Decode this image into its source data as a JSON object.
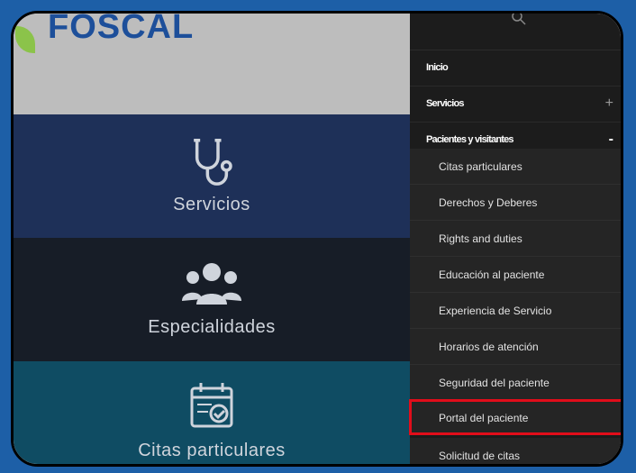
{
  "brand": {
    "logo_text": "FOSCAL"
  },
  "tiles": [
    {
      "label": "Servicios",
      "icon": "stethoscope-icon"
    },
    {
      "label": "Especialidades",
      "icon": "people-group-icon"
    },
    {
      "label": "Citas particulares",
      "icon": "calendar-check-icon"
    }
  ],
  "menu": {
    "search_icon": "search-icon",
    "items": [
      {
        "label": "Inicio",
        "sign": ""
      },
      {
        "label": "Servicios",
        "sign": "+"
      },
      {
        "label": "Pacientes y visitantes",
        "sign": "-"
      }
    ],
    "subitems": [
      {
        "label": "Citas particulares"
      },
      {
        "label": "Derechos y Deberes"
      },
      {
        "label": "Rights and duties"
      },
      {
        "label": "Educación al paciente"
      },
      {
        "label": "Experiencia de Servicio"
      },
      {
        "label": "Horarios de atención"
      },
      {
        "label": "Seguridad del paciente"
      },
      {
        "label": "Portal del paciente"
      },
      {
        "label": "Solicitud de citas"
      }
    ],
    "highlighted_subitem": "Portal del paciente"
  },
  "colors": {
    "background": "#1d5fa7",
    "tile_services": "#1e3058",
    "tile_specialties": "#171d27",
    "tile_appointments": "#0f4c63",
    "menu_bg": "#1c1c1c",
    "highlight": "#e10d1a"
  }
}
